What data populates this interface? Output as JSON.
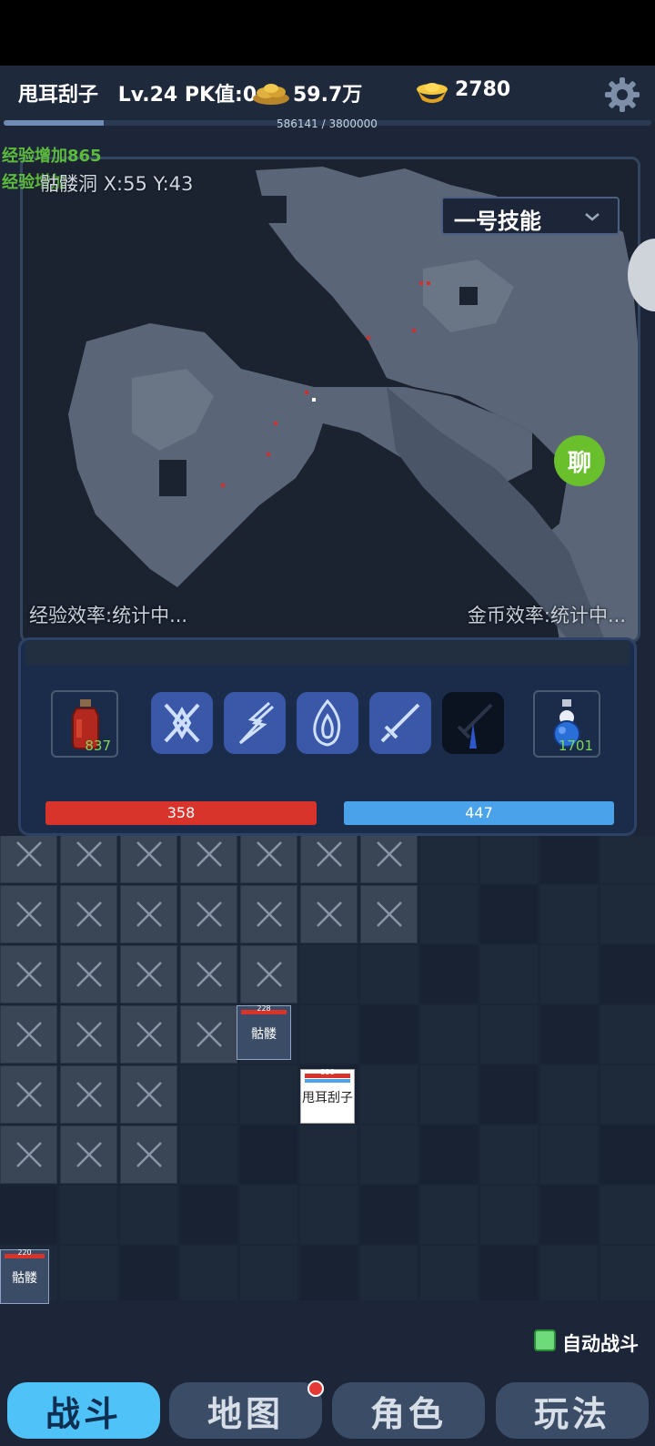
{
  "header": {
    "player_name": "甩耳刮子",
    "level_pk": "Lv.24 PK值:0",
    "gold": "59.7万",
    "ingot": "2780",
    "exp_text": "586141 / 3800000",
    "exp_progress": 0.154
  },
  "messages": [
    "经验增加865",
    "经验增加"
  ],
  "map": {
    "location": "骷髅洞 X:55 Y:43",
    "skill_select": "一号技能",
    "chat_label": "聊",
    "exp_rate": "经验效率:统计中...",
    "gold_rate": "金币效率:统计中..."
  },
  "controls": {
    "hp_potion_count": "837",
    "mp_potion_count": "1701",
    "hp": "358",
    "mp": "447"
  },
  "battle": {
    "monster1": {
      "name": "骷髅",
      "hp": "228"
    },
    "monster2": {
      "name": "骷髅",
      "hp": "220"
    },
    "player": {
      "name": "甩耳刮子",
      "hp": "358"
    }
  },
  "auto_battle": "自动战斗",
  "nav": [
    "战斗",
    "地图",
    "角色",
    "玩法"
  ],
  "colors": {
    "accent": "#4fc3f7",
    "hp": "#d9342b",
    "mp": "#4aa3ea",
    "exp_msg": "#5dbb3c"
  }
}
